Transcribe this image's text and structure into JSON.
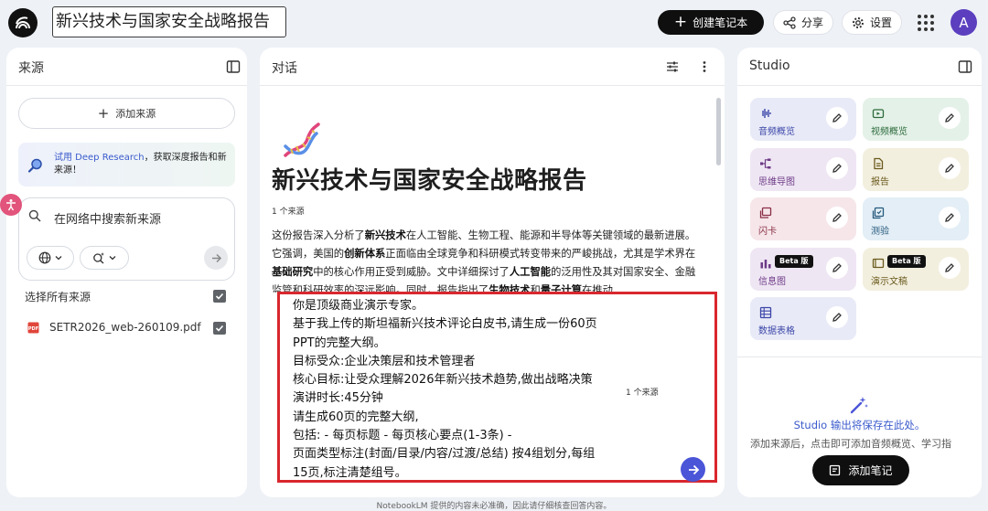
{
  "header": {
    "notebook_title": "新兴技术与国家安全战略报告",
    "create_label": "创建笔记本",
    "share_label": "分享",
    "settings_label": "设置",
    "avatar_initial": "A"
  },
  "sources_panel": {
    "title": "来源",
    "add_source_label": "添加来源",
    "deep_research": {
      "link": "试用 Deep Research",
      "rest": "，获取深度报告和新来源！"
    },
    "web_search_placeholder": "在网络中搜索新来源",
    "select_all_label": "选择所有来源",
    "files": [
      {
        "name": "SETR2026_web-260109.pdf",
        "checked": true
      }
    ]
  },
  "chat_panel": {
    "title": "对话",
    "doc_title": "新兴技术与国家安全战略报告",
    "source_count": "1 个来源",
    "summary": {
      "s1": "这份报告深入分析了",
      "b1": "新兴技术",
      "s2": "在人工智能、生物工程、能源和半导体等关键领域的最新进展。它强调，美国的",
      "b2": "创新体系",
      "s3": "正面临由全球竞争和科研模式转变带来的严峻挑战，尤其是学术界在",
      "b3": "基础研究",
      "s4": "中的核心作用正受到威胁。文中详细探讨了",
      "b4": "人工智能",
      "s5": "的泛用性及其对国家安全、金融监管和科研效率的深远影响。同时，报告指出了",
      "b5": "生物技术",
      "s6": "和",
      "b6": "量子计算",
      "s7": "在推动"
    },
    "prompt": "你是顶级商业演示专家。\n基于我上传的斯坦福新兴技术评论白皮书,请生成一份60页PPT的完整大纲。\n目标受众:企业决策层和技术管理者\n核心目标:让受众理解2026年新兴技术趋势,做出战略决策\n演讲时长:45分钟\n请生成60页的完整大纲,\n包括: - 每页标题 - 每页核心要点(1-3条) -\n页面类型标注(封面/目录/内容/过渡/总结) 按4组划分,每组15页,标注清楚组号。",
    "prompt_source_count": "1 个来源"
  },
  "studio_panel": {
    "title": "Studio",
    "tiles": [
      {
        "label": "音频概览",
        "icon": "audio-waveform-icon",
        "bg": "#e8eaf7",
        "color": "#3b46a8"
      },
      {
        "label": "视频概览",
        "icon": "video-icon",
        "bg": "#e4f1e8",
        "color": "#2c6b3c"
      },
      {
        "label": "思维导图",
        "icon": "mind-map-icon",
        "bg": "#efe6f4",
        "color": "#6e3b86"
      },
      {
        "label": "报告",
        "icon": "report-icon",
        "bg": "#f3efdf",
        "color": "#6a5a1c"
      },
      {
        "label": "闪卡",
        "icon": "flashcards-icon",
        "bg": "#f6e6ea",
        "color": "#8a2f45"
      },
      {
        "label": "测验",
        "icon": "quiz-icon",
        "bg": "#e3eef6",
        "color": "#25597c"
      },
      {
        "label": "信息图",
        "icon": "infographic-icon",
        "bg": "#efe6f4",
        "color": "#6e3b86",
        "badge": "Beta 版"
      },
      {
        "label": "演示文稿",
        "icon": "slides-icon",
        "bg": "#f3efdf",
        "color": "#6a5a1c",
        "badge": "Beta 版"
      },
      {
        "label": "数据表格",
        "icon": "data-table-icon",
        "bg": "#e8eaf7",
        "color": "#3b46a8"
      }
    ],
    "save_note": "Studio 输出将保存在此处。",
    "hint": "添加来源后，点击即可添加音频概览、学习指",
    "add_note_label": "添加笔记"
  },
  "footer": {
    "disclaimer": "NotebookLM 提供的内容未必准确，因此请仔细核查回答内容。"
  }
}
